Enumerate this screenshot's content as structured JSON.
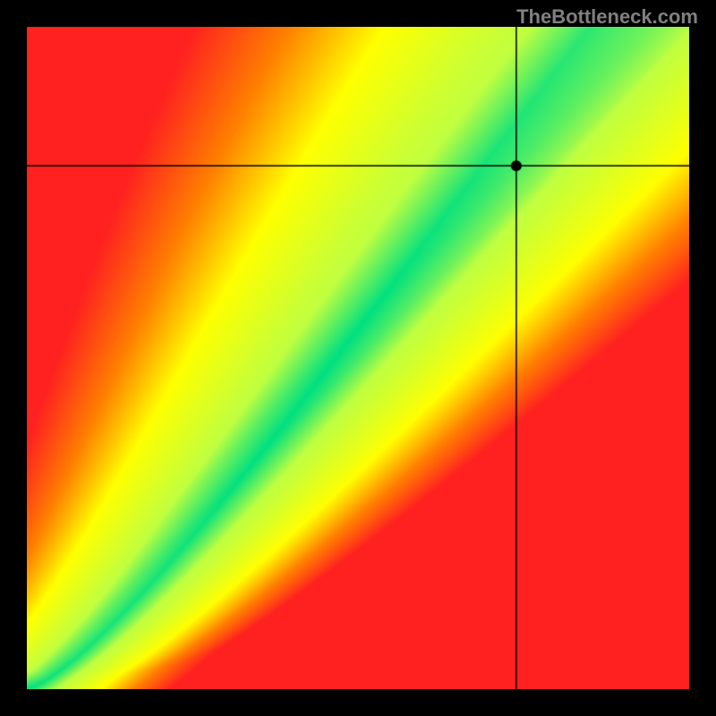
{
  "watermark": "TheBottleneck.com",
  "chart_data": {
    "type": "heatmap",
    "title": "",
    "xlabel": "",
    "ylabel": "",
    "xlim": [
      0,
      1
    ],
    "ylim": [
      0,
      1
    ],
    "colormap_stops": [
      {
        "t": 0.0,
        "color": "#ff2020"
      },
      {
        "t": 0.25,
        "color": "#ff8000"
      },
      {
        "t": 0.5,
        "color": "#ffff00"
      },
      {
        "t": 0.85,
        "color": "#c0ff40"
      },
      {
        "t": 1.0,
        "color": "#00e080"
      }
    ],
    "ridge_description": "superlinear ridge from bottom-left corner curving to meet top edge near x≈0.82; narrow green band along ridge, falling off through yellow/orange to red",
    "crosshair": {
      "x": 0.74,
      "y": 0.79
    },
    "marker": {
      "x": 0.74,
      "y": 0.79,
      "shape": "circle",
      "color": "#000"
    }
  }
}
